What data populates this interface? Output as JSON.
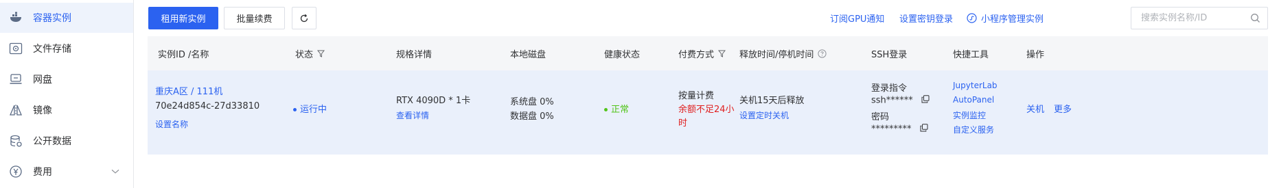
{
  "sidebar": {
    "items": [
      {
        "label": "容器实例",
        "icon": "container-icon",
        "active": true
      },
      {
        "label": "文件存储",
        "icon": "file-storage-icon"
      },
      {
        "label": "网盘",
        "icon": "cloud-drive-icon"
      },
      {
        "label": "镜像",
        "icon": "image-icon"
      },
      {
        "label": "公开数据",
        "icon": "database-icon"
      },
      {
        "label": "费用",
        "icon": "yen-icon",
        "expandable": true
      }
    ]
  },
  "toolbar": {
    "new_instance": "租用新实例",
    "batch_renew": "批量续费",
    "refresh_icon": "refresh-icon",
    "subscribe_gpu": "订阅GPU通知",
    "set_key_login": "设置密钥登录",
    "miniprogram": "小程序管理实例",
    "search_placeholder": "搜索实例名称/ID"
  },
  "table": {
    "headers": {
      "id_name": "实例ID /名称",
      "status": "状态",
      "spec": "规格详情",
      "disk": "本地磁盘",
      "health": "健康状态",
      "billing": "付费方式",
      "release": "释放时间/停机时间",
      "ssh": "SSH登录",
      "tools": "快捷工具",
      "actions": "操作"
    },
    "rows": [
      {
        "name": "重庆A区 / 111机",
        "id": "70e24d854c-27d33810",
        "set_name": "设置名称",
        "status": "运行中",
        "gpu": "RTX 4090D * 1卡",
        "view_detail": "查看详情",
        "system_disk": "系统盘 0%",
        "data_disk": "数据盘 0%",
        "health": "正常",
        "billing": "按量计费",
        "warning_line1": "余额不足24小",
        "warning_line2": "时",
        "release": "关机15天后释放",
        "set_shutdown": "设置定时关机",
        "ssh_cmd_label": "登录指令",
        "ssh_cmd": "ssh******",
        "password_label": "密码",
        "password": "*********",
        "tools": [
          "JupyterLab",
          "AutoPanel",
          "实例监控",
          "自定义服务"
        ],
        "shutdown": "关机",
        "more": "更多"
      }
    ]
  },
  "colors": {
    "accent": "#2b62f0",
    "running": "#2b62f0",
    "healthy": "#52c41a",
    "warning": "#e02020",
    "row_bg": "#eaf0fb",
    "header_bg": "#f5f6f8"
  }
}
